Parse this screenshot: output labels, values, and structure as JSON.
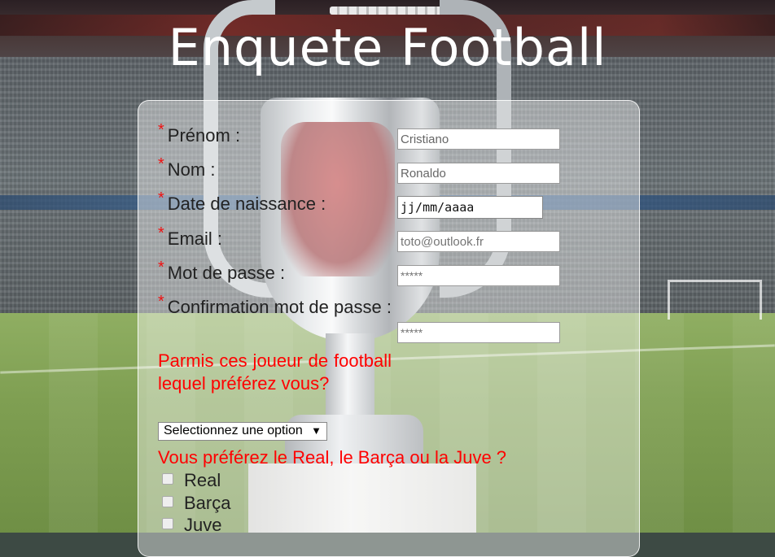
{
  "page": {
    "title": "Enquete Football"
  },
  "form": {
    "fields": [
      {
        "label": "Prénom :",
        "value": "Cristiano",
        "required_mark": "*"
      },
      {
        "label": "Nom :",
        "value": "Ronaldo",
        "required_mark": "*"
      },
      {
        "label": "Date de naissance :",
        "value": "jj/mm/aaaa",
        "required_mark": "*"
      },
      {
        "label": "Email :",
        "placeholder": "toto@outlook.fr",
        "required_mark": "*"
      },
      {
        "label": "Mot de passe :",
        "placeholder": "*****",
        "required_mark": "*"
      },
      {
        "label": "Confirmation mot de passe :",
        "placeholder": "*****",
        "required_mark": "*"
      }
    ],
    "question1": "Parmis ces joueur de football lequel préférez vous?",
    "select": {
      "selected": "Selectionnez une option",
      "arrow": "▼"
    },
    "question2": "Vous préférez le Real, le Barça ou la Juve ?",
    "clubs": [
      "Real",
      "Barça",
      "Juve"
    ]
  },
  "colors": {
    "required": "#ee1111",
    "question": "#ff0000",
    "title": "#ffffff"
  }
}
